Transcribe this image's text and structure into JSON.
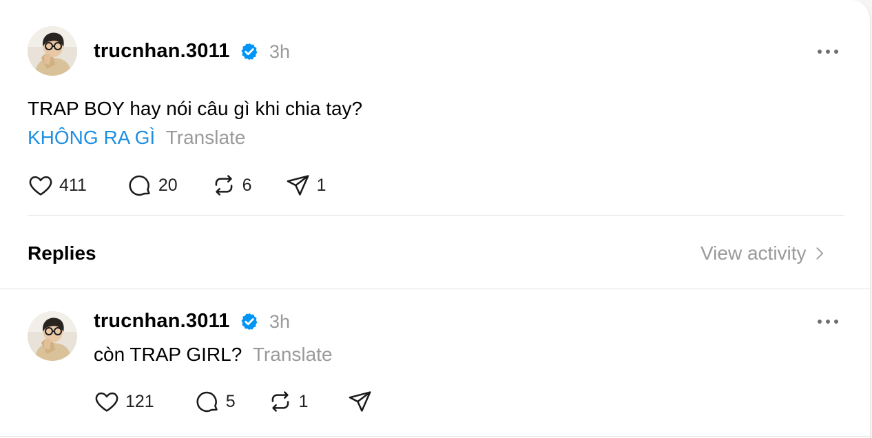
{
  "post": {
    "username": "trucnhan.3011",
    "time": "3h",
    "text_line1": "TRAP BOY hay nói câu gì khi chia tay?",
    "text_link": "KHÔNG RA GÌ",
    "translate": "Translate",
    "likes": "411",
    "comments": "20",
    "reposts": "6",
    "shares": "1"
  },
  "replies_header": {
    "title": "Replies",
    "view_activity": "View activity"
  },
  "reply": {
    "username": "trucnhan.3011",
    "time": "3h",
    "text": "còn TRAP GIRL?",
    "translate": "Translate",
    "likes": "121",
    "comments": "5",
    "reposts": "1"
  },
  "colors": {
    "verified": "#0095f6",
    "link": "#1d8fe3",
    "muted": "#9a9a9a"
  }
}
